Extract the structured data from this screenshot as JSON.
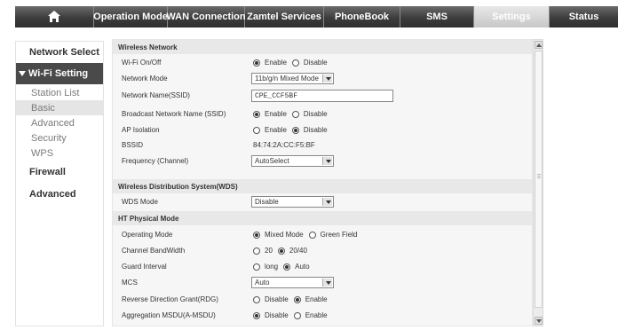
{
  "nav": {
    "home_icon": "home-icon",
    "tabs": [
      {
        "label": "Operation Mode"
      },
      {
        "label": "WAN Connection"
      },
      {
        "label": "Zamtel Services"
      },
      {
        "label": "PhoneBook"
      },
      {
        "label": "SMS"
      },
      {
        "label": "Settings"
      },
      {
        "label": "Status"
      }
    ],
    "active_tab": "Settings"
  },
  "sidebar": {
    "network_select": "Network Select",
    "wifi_setting": "Wi-Fi Setting",
    "items": [
      {
        "label": "Station List"
      },
      {
        "label": "Basic"
      },
      {
        "label": "Advanced"
      },
      {
        "label": "Security"
      },
      {
        "label": "WPS"
      }
    ],
    "active_item": "Basic",
    "firewall": "Firewall",
    "advanced": "Advanced"
  },
  "wireless_network": {
    "title": "Wireless Network",
    "wifi_onoff": {
      "label": "Wi-Fi On/Off",
      "options": [
        "Enable",
        "Disable"
      ],
      "selected": "Enable"
    },
    "network_mode": {
      "label": "Network Mode",
      "value": "11b/g/n Mixed Mode"
    },
    "ssid": {
      "label": "Network Name(SSID)",
      "value": "CPE_CCF5BF"
    },
    "broadcast": {
      "label": "Broadcast Network Name (SSID)",
      "options": [
        "Enable",
        "Disable"
      ],
      "selected": "Enable"
    },
    "ap_isolation": {
      "label": "AP Isolation",
      "options": [
        "Enable",
        "Disable"
      ],
      "selected": "Disable"
    },
    "bssid": {
      "label": "BSSID",
      "value": "84:74:2A:CC:F5:BF"
    },
    "frequency": {
      "label": "Frequency (Channel)",
      "value": "AutoSelect"
    }
  },
  "wds": {
    "title": "Wireless Distribution System(WDS)",
    "mode": {
      "label": "WDS Mode",
      "value": "Disable"
    }
  },
  "ht_physical": {
    "title": "HT Physical Mode",
    "operating_mode": {
      "label": "Operating Mode",
      "options": [
        "Mixed Mode",
        "Green Field"
      ],
      "selected": "Mixed Mode"
    },
    "bandwidth": {
      "label": "Channel BandWidth",
      "options": [
        "20",
        "20/40"
      ],
      "selected": "20/40"
    },
    "guard_interval": {
      "label": "Guard Interval",
      "options": [
        "long",
        "Auto"
      ],
      "selected": "Auto"
    },
    "mcs": {
      "label": "MCS",
      "value": "Auto"
    },
    "rdg": {
      "label": "Reverse Direction Grant(RDG)",
      "options": [
        "Disable",
        "Enable"
      ],
      "selected": "Enable"
    },
    "amsdu": {
      "label": "Aggregation MSDU(A-MSDU)",
      "options": [
        "Disable",
        "Enable"
      ],
      "selected": "Disable"
    }
  }
}
